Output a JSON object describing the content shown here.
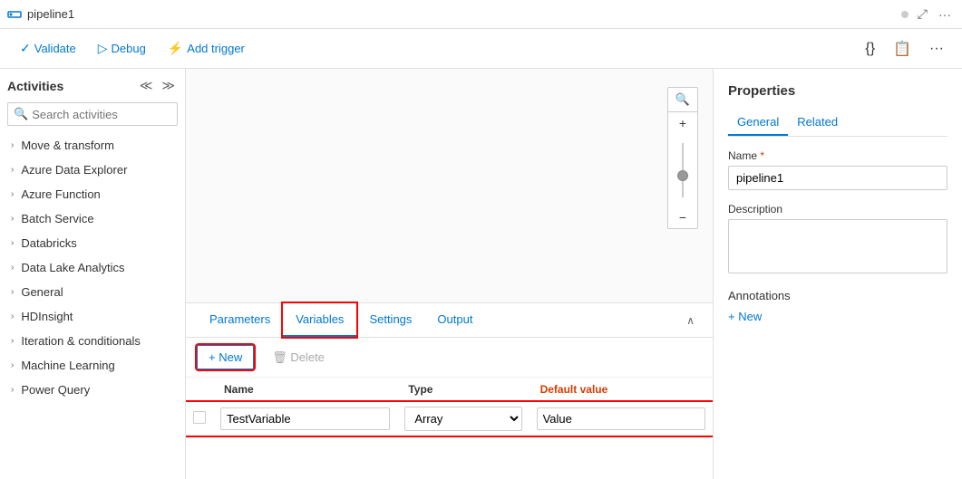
{
  "titlebar": {
    "icon": "pipeline-icon",
    "title": "pipeline1",
    "dot": "●"
  },
  "toolbar": {
    "validate_label": "Validate",
    "debug_label": "Debug",
    "add_trigger_label": "Add trigger",
    "validate_icon": "✓",
    "debug_icon": "▷",
    "trigger_icon": "⚡"
  },
  "sidebar": {
    "title": "Activities",
    "collapse_icons": [
      "≪",
      "≫"
    ],
    "search_placeholder": "Search activities",
    "items": [
      {
        "label": "Move & transform"
      },
      {
        "label": "Azure Data Explorer"
      },
      {
        "label": "Azure Function"
      },
      {
        "label": "Batch Service"
      },
      {
        "label": "Databricks"
      },
      {
        "label": "Data Lake Analytics"
      },
      {
        "label": "General"
      },
      {
        "label": "HDInsight"
      },
      {
        "label": "Iteration & conditionals"
      },
      {
        "label": "Machine Learning"
      },
      {
        "label": "Power Query"
      }
    ]
  },
  "canvas": {
    "zoom_plus": "+",
    "zoom_minus": "−",
    "zoom_search": "🔍"
  },
  "bottom_panel": {
    "tabs": [
      {
        "label": "Parameters",
        "active": false
      },
      {
        "label": "Variables",
        "active": true
      },
      {
        "label": "Settings",
        "active": false
      },
      {
        "label": "Output",
        "active": false
      }
    ],
    "collapse_icon": "∧",
    "new_button": "+ New",
    "delete_button": "🗑 Delete",
    "table": {
      "headers": [
        {
          "label": "Name",
          "class": "col-name"
        },
        {
          "label": "Type",
          "class": "col-type"
        },
        {
          "label": "Default value",
          "class": "col-default"
        }
      ],
      "rows": [
        {
          "name": "TestVariable",
          "type": "Array",
          "default": "Value"
        }
      ]
    }
  },
  "properties": {
    "title": "Properties",
    "tabs": [
      {
        "label": "General",
        "active": true
      },
      {
        "label": "Related",
        "active": false
      }
    ],
    "name_label": "Name",
    "name_required": "*",
    "name_value": "pipeline1",
    "description_label": "Description",
    "description_value": "",
    "annotations_label": "Annotations",
    "add_new_label": "+ New"
  }
}
